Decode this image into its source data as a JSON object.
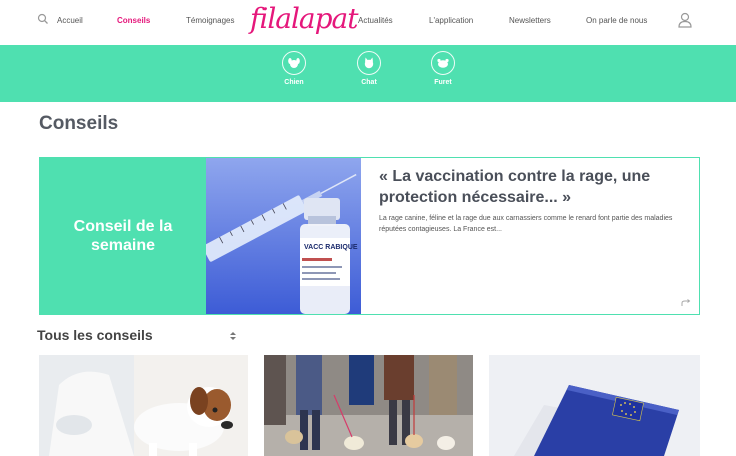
{
  "header": {
    "logo": "filalapat",
    "nav": [
      {
        "label": "Accueil",
        "active": false
      },
      {
        "label": "Conseils",
        "active": true
      },
      {
        "label": "Témoignages",
        "active": false
      },
      {
        "label": "Actualités",
        "active": false
      },
      {
        "label": "L'application",
        "active": false
      },
      {
        "label": "Newsletters",
        "active": false
      },
      {
        "label": "On parle de nous",
        "active": false
      }
    ],
    "icons": {
      "search": "search-icon",
      "user": "user-icon"
    }
  },
  "categories": [
    {
      "label": "Chien",
      "icon": "dog-icon"
    },
    {
      "label": "Chat",
      "icon": "cat-icon"
    },
    {
      "label": "Furet",
      "icon": "ferret-icon"
    }
  ],
  "page": {
    "title": "Conseils"
  },
  "featured": {
    "badge": "Conseil de la semaine",
    "title": "« La vaccination contre la rage, une protection nécessaire... »",
    "excerpt": "La rage canine, féline et la rage due aux carnassiers comme le renard font partie des maladies réputées contagieuses. La France est...",
    "vial_label": "VACC RABIQUE"
  },
  "all_tips": {
    "title": "Tous les conseils"
  },
  "colors": {
    "accent": "#4fe0b0",
    "brand": "#e5177b",
    "text": "#555a63"
  }
}
